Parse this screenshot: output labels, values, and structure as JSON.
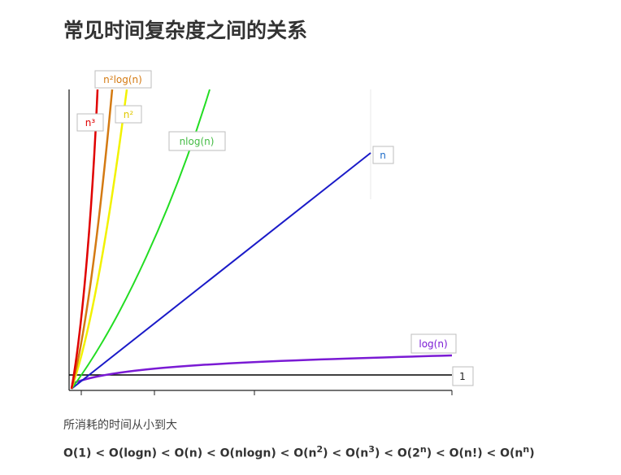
{
  "heading": "常见时间复杂度之间的关系",
  "chart_data": {
    "type": "line",
    "title": "",
    "xlabel": "",
    "ylabel": "",
    "grid": false,
    "series": [
      {
        "name": "n³",
        "color": "#e00000"
      },
      {
        "name": "n²log(n)",
        "color": "#d47a12"
      },
      {
        "name": "n²",
        "color": "#f2f200"
      },
      {
        "name": "nlog(n)",
        "color": "#22dd22"
      },
      {
        "name": "n",
        "color": "#1a1ac8"
      },
      {
        "name": "log(n)",
        "color": "#7a1ad4"
      },
      {
        "name": "1",
        "color": "#000000"
      }
    ]
  },
  "description": "所消耗的时间从小到大",
  "order": [
    {
      "text": "O(1) < O(logn) < O(n) < O(nlogn) < O(n"
    },
    {
      "sup": "2"
    },
    {
      "text": ") < O(n"
    },
    {
      "sup": "3"
    },
    {
      "text": ") < O(2"
    },
    {
      "sup": "n"
    },
    {
      "text": ") < O(n!) < O(n"
    },
    {
      "sup": "n"
    },
    {
      "text": ")"
    }
  ]
}
